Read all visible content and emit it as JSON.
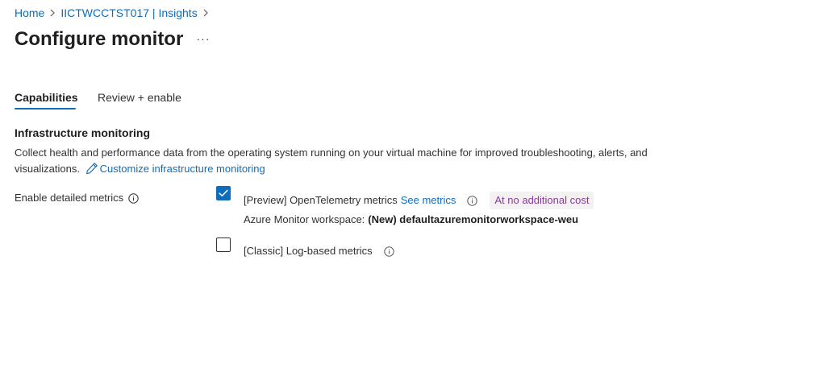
{
  "breadcrumb": {
    "items": [
      "Home",
      "IICTWCCTST017 | Insights"
    ]
  },
  "page": {
    "title": "Configure monitor",
    "more_label": "···"
  },
  "tabs": [
    {
      "label": "Capabilities",
      "selected": true
    },
    {
      "label": "Review + enable",
      "selected": false
    }
  ],
  "section": {
    "title": "Infrastructure monitoring",
    "description": "Collect health and performance data from the operating system running on your virtual machine for improved troubleshooting, alerts, and visualizations.",
    "customize_link": "Customize infrastructure monitoring"
  },
  "detailed_metrics": {
    "label": "Enable detailed metrics",
    "options": [
      {
        "label": "[Preview] OpenTelemetry metrics",
        "link": "See metrics",
        "badge": "At no additional cost",
        "checked": true
      },
      {
        "label": "[Classic] Log-based metrics",
        "checked": false
      }
    ],
    "workspace_label": "Azure Monitor workspace:",
    "workspace_value": "(New) defaultazuremonitorworkspace-weu"
  },
  "colors": {
    "accent": "#0f6cbd",
    "badge_text": "#8a3a9e",
    "badge_bg": "#f3f2f1"
  }
}
